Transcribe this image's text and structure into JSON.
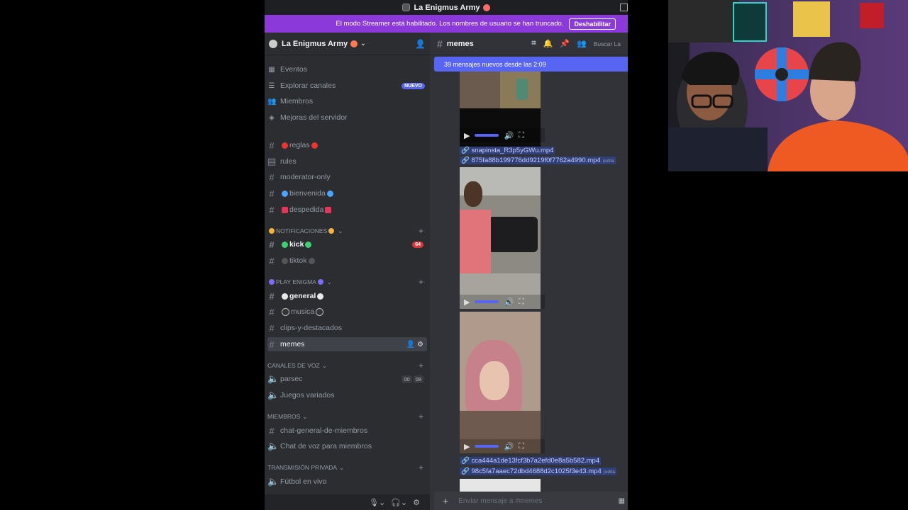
{
  "window": {
    "title": "La Enigmus Army"
  },
  "banner": {
    "text": "El modo Streamer está habilitado. Los nombres de usuario se han truncado.",
    "button": "Deshabilitar"
  },
  "server": {
    "name": "La Enigmus Army"
  },
  "menu": [
    {
      "label": "Eventos",
      "icon": "calendar-icon"
    },
    {
      "label": "Explorar canales",
      "icon": "browse-icon",
      "badge": "NUEVO"
    },
    {
      "label": "Miembros",
      "icon": "members-icon"
    },
    {
      "label": "Mejoras del servidor",
      "icon": "boost-icon"
    }
  ],
  "channels_top": [
    {
      "label": "reglas",
      "icon": "hash"
    },
    {
      "label": "rules",
      "icon": "rules-icon"
    },
    {
      "label": "moderator-only",
      "icon": "hash"
    },
    {
      "label": "bienvenida",
      "icon": "hash"
    },
    {
      "label": "despedida",
      "icon": "hash"
    }
  ],
  "categories": {
    "notificaciones": "NOTIFICACIONES",
    "play_enigma": "PLAY ENIGMA",
    "voz": "CANALES DE VOZ",
    "miembros": "MIEMBROS",
    "privada": "TRANSMISIÓN PRIVADA"
  },
  "notif_channels": [
    {
      "label": "kick",
      "ping": "64"
    },
    {
      "label": "tiktok"
    }
  ],
  "play_channels": [
    {
      "label": "general"
    },
    {
      "label": "musica"
    },
    {
      "label": "clips-y-destacados"
    },
    {
      "label": "memes"
    }
  ],
  "voice_channels": [
    {
      "label": "parsec",
      "counts": [
        "00",
        "08"
      ]
    },
    {
      "label": "Juegos variados"
    }
  ],
  "member_channels": [
    {
      "label": "chat-general-de-miembros"
    },
    {
      "label": "Chat de voz para miembros"
    }
  ],
  "private_channels": [
    {
      "label": "Fútbol en vivo"
    }
  ],
  "main": {
    "channel": "memes",
    "search": "Buscar La",
    "new_messages": "39 mensajes nuevos desde las 2:09",
    "links": [
      "snapinsta_R3p5yGWu.mp4",
      "875fa88b199776dd9219f0f7762a4990.mp4",
      "cca444a1de13fcf3b7a2efd0e8a5b582.mp4",
      "98c5fa7aaec72dbd4688d2c1025f3e43.mp4"
    ],
    "edited": "(edita",
    "composer_placeholder": "Enviar mensaje a #memes"
  },
  "colors": {
    "banner": "#8b3ad9",
    "accent": "#5865f2",
    "sidebar": "#2b2d31",
    "chat": "#313338",
    "ping": "#da373c"
  }
}
